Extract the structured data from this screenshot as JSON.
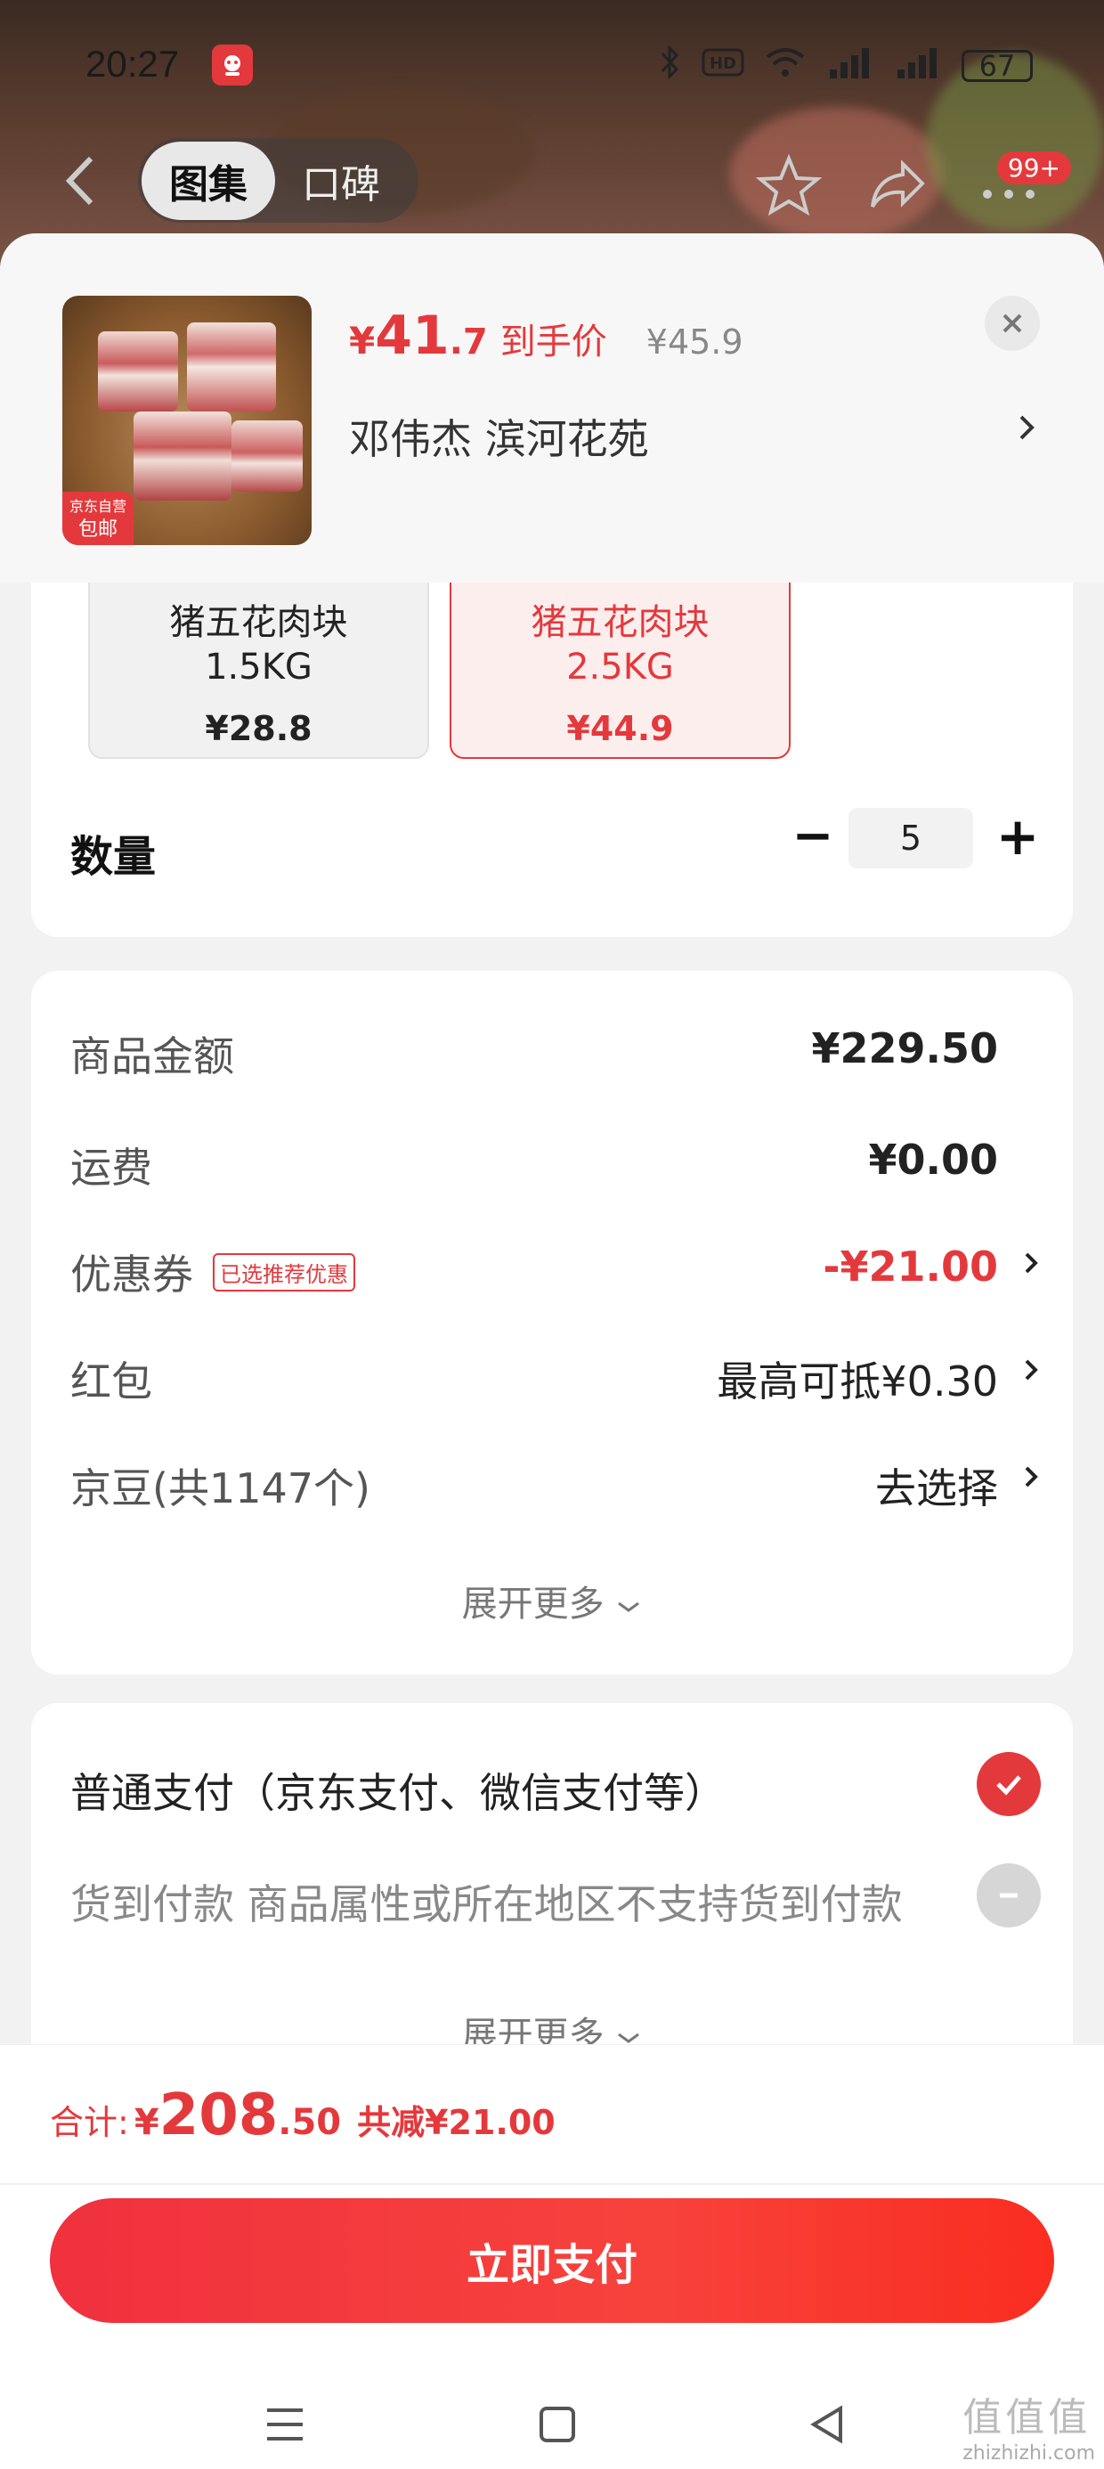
{
  "status_bar": {
    "time": "20:27",
    "battery": "67"
  },
  "top_nav": {
    "tab_active": "图集",
    "tab_inactive": "口碑",
    "badge": "99+"
  },
  "product": {
    "price_currency": "¥",
    "price_int": "41",
    "price_dec": ".7",
    "price_tag": "到手价",
    "original_price": "¥45.9",
    "address": "邓伟杰  滨河花苑",
    "thumb_tag_line1": "京东自营",
    "thumb_tag_line2": "包邮"
  },
  "skus": [
    {
      "name_line1": "猪五花肉块",
      "name_line2": "1.5KG",
      "price": "¥28.8",
      "selected": false
    },
    {
      "name_line1": "猪五花肉块",
      "name_line2": "2.5KG",
      "price": "¥44.9",
      "selected": true
    }
  ],
  "quantity": {
    "label": "数量",
    "value": "5",
    "minus": "−",
    "plus": "+"
  },
  "fees": {
    "goods_label": "商品金额",
    "goods_value": "¥229.50",
    "shipping_label": "运费",
    "shipping_value": "¥0.00",
    "coupon_label": "优惠券",
    "coupon_tag": "已选推荐优惠",
    "coupon_value": "-¥21.00",
    "redpacket_label": "红包",
    "redpacket_value": "最高可抵¥0.30",
    "beans_label": "京豆(共1147个)",
    "beans_value": "去选择",
    "expand": "展开更多"
  },
  "payment": {
    "normal_label": "普通支付（京东支付、微信支付等）",
    "cod_label": "货到付款 商品属性或所在地区不支持货到付款",
    "expand": "展开更多"
  },
  "summary": {
    "label": "合计:",
    "currency": "¥",
    "int": "208",
    "dec": ".50",
    "saving": "共减¥21.00",
    "pay_button": "立即支付"
  },
  "watermark": {
    "big": "值值值",
    "small": "zhizhizhi.com"
  },
  "colors": {
    "accent": "#e4393c",
    "background": "#f2f2f2"
  }
}
